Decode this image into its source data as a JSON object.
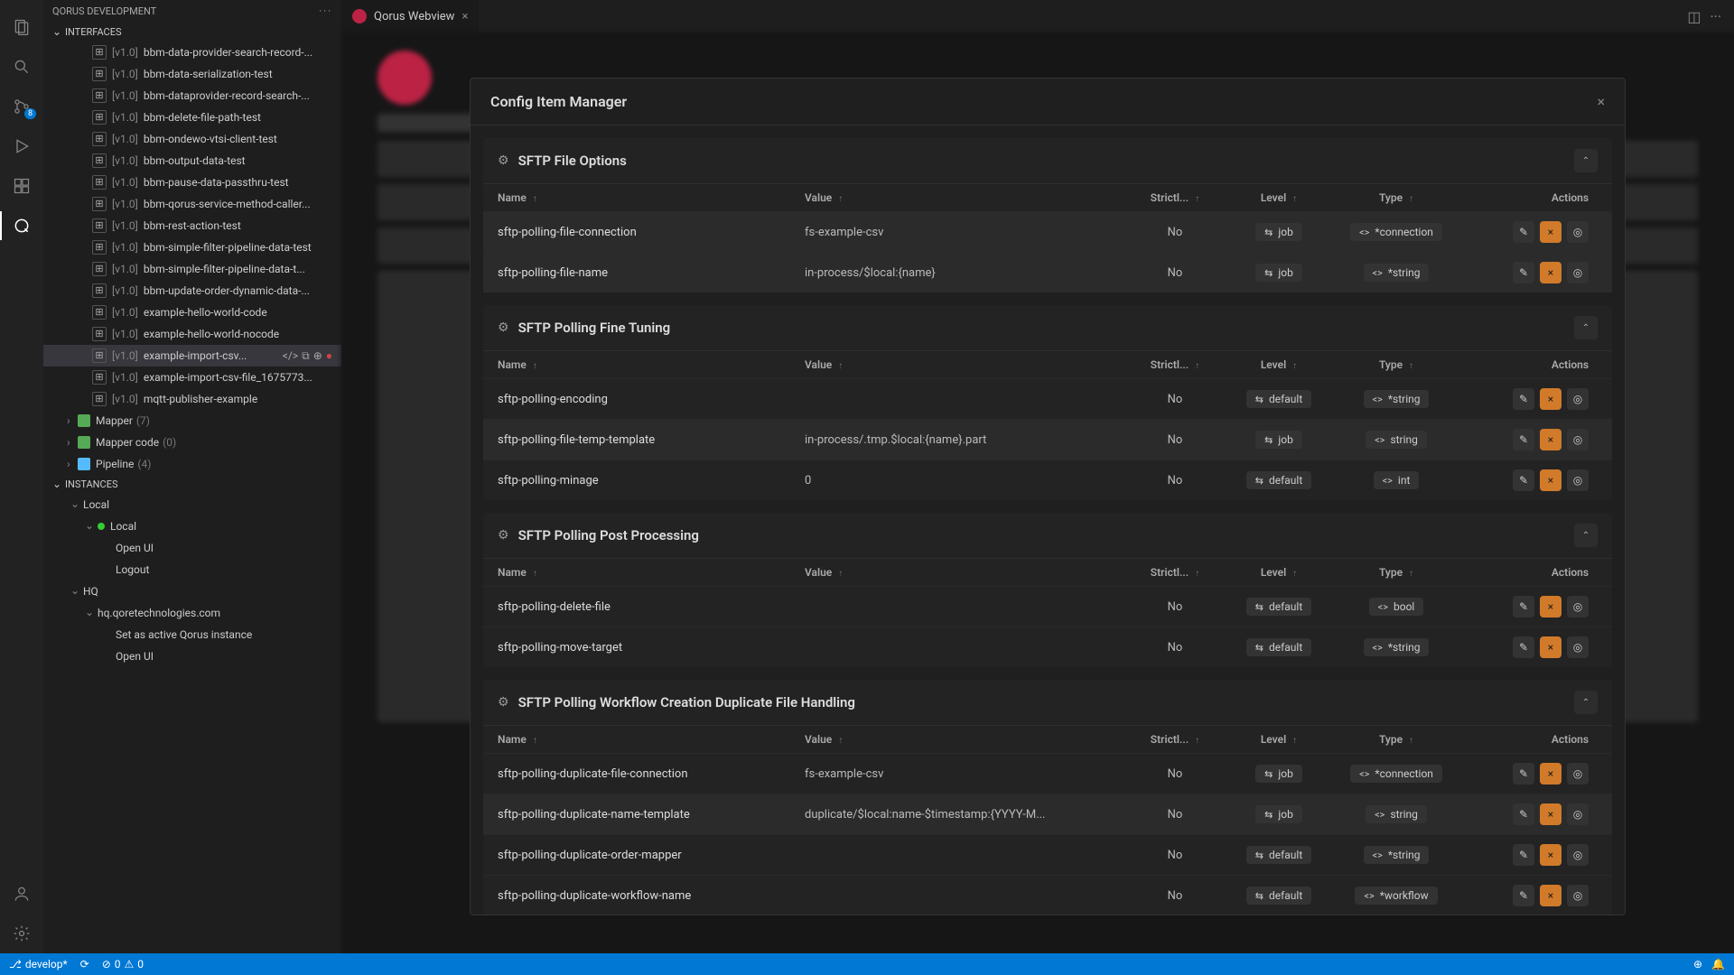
{
  "sidebar": {
    "title": "QORUS DEVELOPMENT",
    "sections": {
      "interfaces": "INTERFACES",
      "instances": "INSTANCES"
    },
    "items": [
      {
        "ver": "[v1.0]",
        "name": "bbm-data-provider-search-record-..."
      },
      {
        "ver": "[v1.0]",
        "name": "bbm-data-serialization-test"
      },
      {
        "ver": "[v1.0]",
        "name": "bbm-dataprovider-record-search-..."
      },
      {
        "ver": "[v1.0]",
        "name": "bbm-delete-file-path-test"
      },
      {
        "ver": "[v1.0]",
        "name": "bbm-ondewo-vtsi-client-test"
      },
      {
        "ver": "[v1.0]",
        "name": "bbm-output-data-test"
      },
      {
        "ver": "[v1.0]",
        "name": "bbm-pause-data-passthru-test"
      },
      {
        "ver": "[v1.0]",
        "name": "bbm-qorus-service-method-caller..."
      },
      {
        "ver": "[v1.0]",
        "name": "bbm-rest-action-test"
      },
      {
        "ver": "[v1.0]",
        "name": "bbm-simple-filter-pipeline-data-test"
      },
      {
        "ver": "[v1.0]",
        "name": "bbm-simple-filter-pipeline-data-t..."
      },
      {
        "ver": "[v1.0]",
        "name": "bbm-update-order-dynamic-data-..."
      },
      {
        "ver": "[v1.0]",
        "name": "example-hello-world-code"
      },
      {
        "ver": "[v1.0]",
        "name": "example-hello-world-nocode"
      },
      {
        "ver": "[v1.0]",
        "name": "example-import-csv..."
      },
      {
        "ver": "[v1.0]",
        "name": "example-import-csv-file_1675773..."
      },
      {
        "ver": "[v1.0]",
        "name": "mqtt-publisher-example"
      }
    ],
    "groups": [
      {
        "name": "Mapper",
        "count": "(7)"
      },
      {
        "name": "Mapper code",
        "count": "(0)"
      },
      {
        "name": "Pipeline",
        "count": "(4)"
      }
    ],
    "instances": {
      "local": "Local",
      "localChild": "Local",
      "openui": "Open UI",
      "logout": "Logout",
      "hq": "HQ",
      "hqhost": "hq.qoretechnologies.com",
      "setactive": "Set as active Qorus instance",
      "openui2": "Open UI"
    }
  },
  "tab": {
    "title": "Qorus Webview"
  },
  "modal": {
    "title": "Config Item Manager",
    "headers": {
      "name": "Name",
      "value": "Value",
      "strict": "Strictl...",
      "level": "Level",
      "type": "Type",
      "actions": "Actions"
    },
    "groups": [
      {
        "title": "SFTP File Options",
        "rows": [
          {
            "name": "sftp-polling-file-connection",
            "value": "fs-example-csv",
            "strict": "No",
            "level": "job",
            "type": "*connection",
            "hl": true
          },
          {
            "name": "sftp-polling-file-name",
            "value": "in-process/$local:{name}",
            "strict": "No",
            "level": "job",
            "type": "*string",
            "hl": true
          }
        ]
      },
      {
        "title": "SFTP Polling Fine Tuning",
        "rows": [
          {
            "name": "sftp-polling-encoding",
            "value": "",
            "strict": "No",
            "level": "default",
            "type": "*string"
          },
          {
            "name": "sftp-polling-file-temp-template",
            "value": "in-process/.tmp.$local:{name}.part",
            "strict": "No",
            "level": "job",
            "type": "string",
            "hl": true
          },
          {
            "name": "sftp-polling-minage",
            "value": "0",
            "strict": "No",
            "level": "default",
            "type": "int"
          }
        ]
      },
      {
        "title": "SFTP Polling Post Processing",
        "rows": [
          {
            "name": "sftp-polling-delete-file",
            "value": "",
            "strict": "No",
            "level": "default",
            "type": "bool"
          },
          {
            "name": "sftp-polling-move-target",
            "value": "",
            "strict": "No",
            "level": "default",
            "type": "*string"
          }
        ]
      },
      {
        "title": "SFTP Polling Workflow Creation Duplicate File Handling",
        "rows": [
          {
            "name": "sftp-polling-duplicate-file-connection",
            "value": "fs-example-csv",
            "strict": "No",
            "level": "job",
            "type": "*connection"
          },
          {
            "name": "sftp-polling-duplicate-name-template",
            "value": "duplicate/$local:name-$timestamp:{YYYY-M...",
            "strict": "No",
            "level": "job",
            "type": "string",
            "hl": true
          },
          {
            "name": "sftp-polling-duplicate-order-mapper",
            "value": "",
            "strict": "No",
            "level": "default",
            "type": "*string"
          },
          {
            "name": "sftp-polling-duplicate-workflow-name",
            "value": "",
            "strict": "No",
            "level": "default",
            "type": "*workflow"
          }
        ]
      }
    ]
  },
  "statusbar": {
    "branch": "develop*",
    "errors": "0",
    "warnings": "0"
  },
  "scm_badge": "8"
}
